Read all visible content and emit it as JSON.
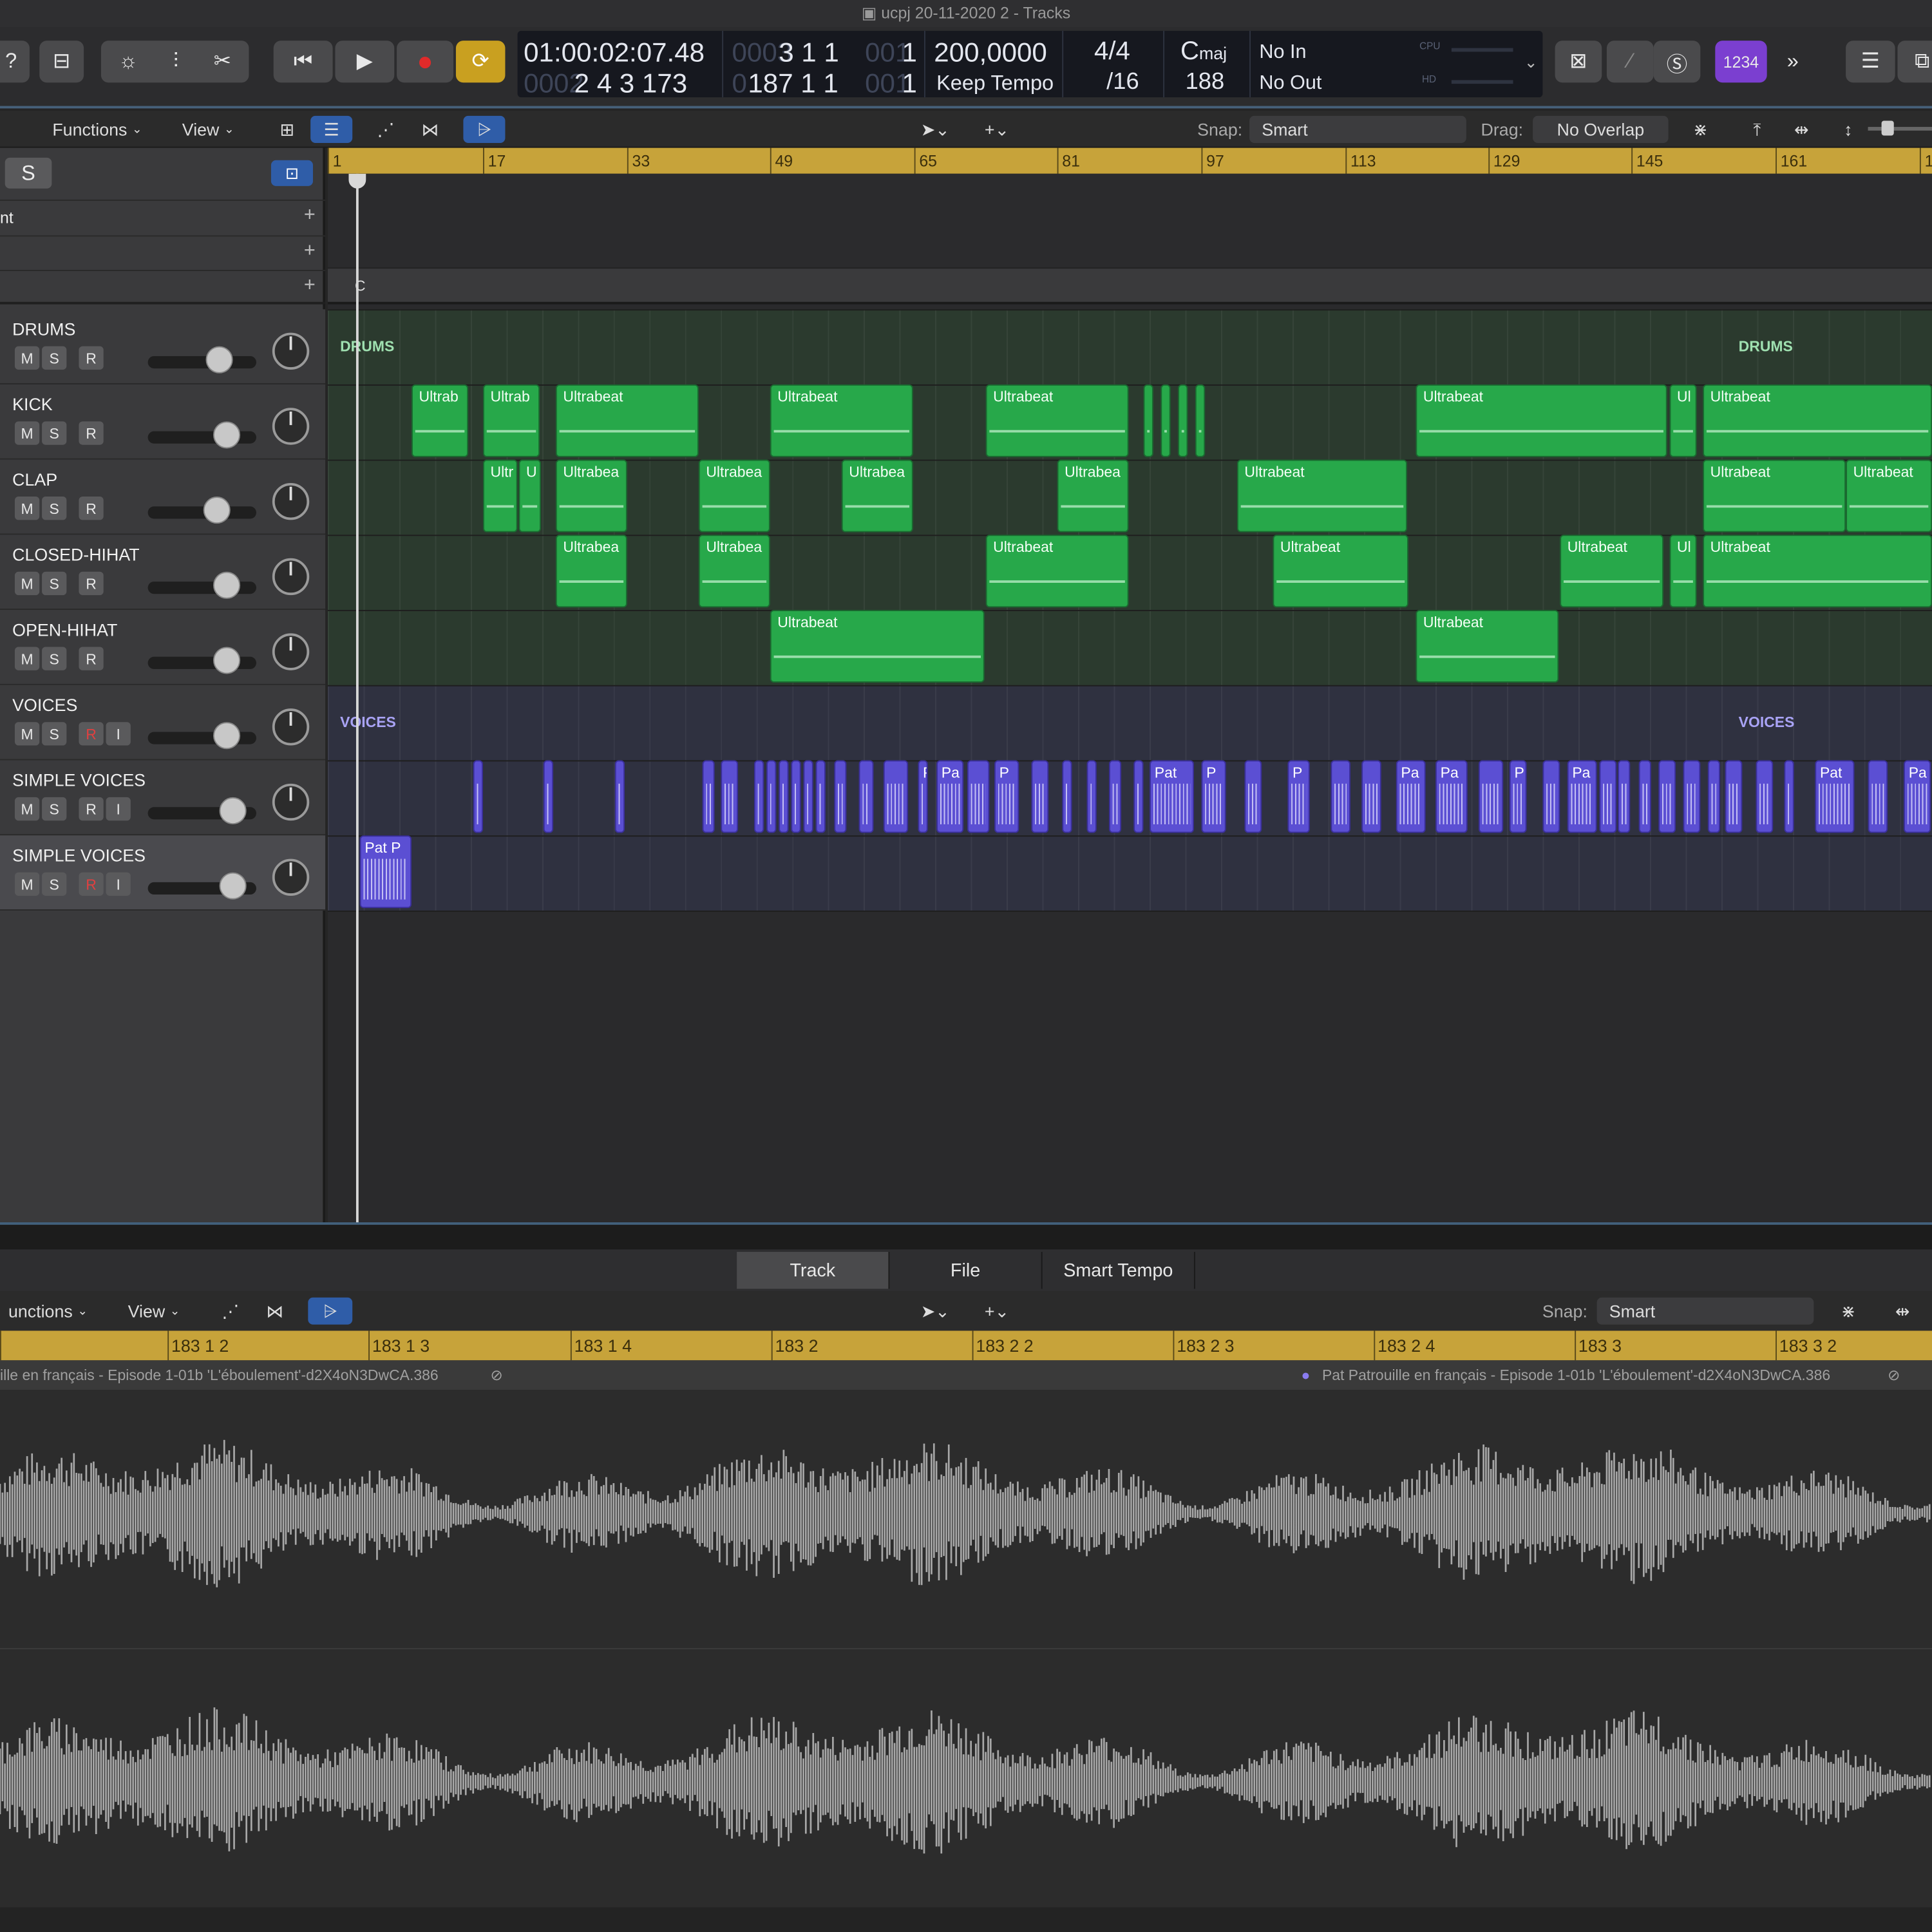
{
  "window": {
    "title": "ucpj 20-11-2020 2 - Tracks"
  },
  "lcd": {
    "time": "01:00:02:07.48",
    "time_bottom_dim": "0002",
    "bars_bottom": "2  4  3  173",
    "pos_top_dim": "0003",
    "pos_top": "3  1  1",
    "pos_top_dim2": "001",
    "pos_top_end": "1",
    "pos_bottom_dim": "0",
    "pos_bottom": "187  1  1",
    "pos_bottom_dim2": "001",
    "pos_bottom_end": "1",
    "tempo": "200,0000",
    "tempo_mode": "Keep Tempo",
    "signature": "4/4",
    "division": "/16",
    "key": "C",
    "key_mode": "maj",
    "key_num": "188",
    "in": "No In",
    "out": "No Out",
    "cpu": "CPU",
    "hd": "HD"
  },
  "controls": {
    "badge": "1234"
  },
  "toolbar": {
    "functions": "Functions",
    "view": "View",
    "snap_label": "Snap:",
    "snap_value": "Smart",
    "drag_label": "Drag:",
    "drag_value": "No Overlap"
  },
  "global": {
    "s_button": "S",
    "row1": "nt",
    "row3_marker": "C"
  },
  "ruler": {
    "ticks": [
      "1",
      "17",
      "33",
      "49",
      "65",
      "81",
      "97",
      "113",
      "129",
      "145",
      "161",
      "1"
    ]
  },
  "tracks": [
    {
      "name": "DRUMS",
      "buttons": [
        "M",
        "S",
        "R"
      ]
    },
    {
      "name": "KICK",
      "buttons": [
        "M",
        "S",
        "R"
      ]
    },
    {
      "name": "CLAP",
      "buttons": [
        "M",
        "S",
        "R"
      ]
    },
    {
      "name": "CLOSED-HIHAT",
      "buttons": [
        "M",
        "S",
        "R"
      ]
    },
    {
      "name": "OPEN-HIHAT",
      "buttons": [
        "M",
        "S",
        "R"
      ]
    },
    {
      "name": "VOICES",
      "buttons": [
        "M",
        "S",
        "R",
        "I"
      ]
    },
    {
      "name": "SIMPLE VOICES",
      "buttons": [
        "M",
        "S",
        "R",
        "I"
      ]
    },
    {
      "name": "SIMPLE VOICES",
      "buttons": [
        "M",
        "S",
        "R",
        "I"
      ]
    }
  ],
  "groups": {
    "drums": "DRUMS",
    "voices": "VOICES"
  },
  "regions": {
    "kick": [
      "Ultrab",
      "Ultrab",
      "Ultrabeat",
      "Ultrabeat",
      "Ultrabeat",
      "",
      "",
      "",
      "",
      "Ultrabeat",
      "Ul",
      "Ultrabeat"
    ],
    "clap": [
      "Ultr",
      "U",
      "Ultrabea",
      "Ultrabea",
      "Ultrabea",
      "Ultrabea",
      "Ultrabeat",
      "Ultrabeat",
      "Ultrabeat"
    ],
    "hihat": [
      "Ultrabea",
      "Ultrabea",
      "Ultrabeat",
      "Ultrabeat",
      "Ultrabeat",
      "Ul",
      "Ultrabeat"
    ],
    "openhat": [
      "Ultrabeat",
      "Ultrabeat"
    ],
    "voices": [
      "P",
      "Pa",
      "P",
      "Pat",
      "P",
      "P",
      "Pa",
      "Pa",
      "P",
      "Pa",
      "Pat",
      "Pa"
    ],
    "simple2": [
      "Pat P"
    ]
  },
  "editor": {
    "tabs": [
      "Track",
      "File",
      "Smart Tempo"
    ],
    "functions": "unctions",
    "view": "View",
    "snap_label": "Snap:",
    "snap_value": "Smart",
    "ruler": [
      "183 1 2",
      "183 1 3",
      "183 1 4",
      "183 2",
      "183 2 2",
      "183 2 3",
      "183 2 4",
      "183 3",
      "183 3 2"
    ],
    "region_left": "ille en français - Episode 1-01b 'L'éboulement'-d2X4oN3DwCA.386",
    "region_right": "Pat Patrouille en français - Episode 1-01b 'L'éboulement'-d2X4oN3DwCA.386"
  },
  "colors": {
    "drums_region": "#27a84a",
    "voices_region": "#5b4fd3",
    "ruler": "#c7a33a",
    "accent_blue": "#2f5da8",
    "badge": "#7b3fd0",
    "record": "#e02a2a",
    "cycle": "#c9a020"
  }
}
